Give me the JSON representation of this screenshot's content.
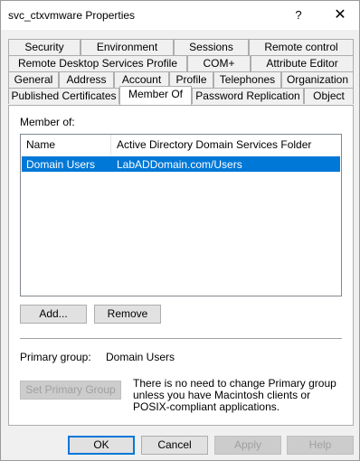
{
  "window": {
    "title": "svc_ctxvmware Properties",
    "help_glyph": "?",
    "close_glyph": "✕"
  },
  "tabs": {
    "row1": [
      "Security",
      "Environment",
      "Sessions",
      "Remote control"
    ],
    "row2": [
      "Remote Desktop Services Profile",
      "COM+",
      "Attribute Editor"
    ],
    "row3": [
      "General",
      "Address",
      "Account",
      "Profile",
      "Telephones",
      "Organization"
    ],
    "row4": [
      "Published Certificates",
      "Member Of",
      "Password Replication",
      "Object"
    ],
    "active": "Member Of"
  },
  "member_of": {
    "label": "Member of:",
    "columns": [
      "Name",
      "Active Directory Domain Services Folder"
    ],
    "rows": [
      {
        "name": "Domain Users",
        "folder": "LabADDomain.com/Users",
        "selected": true
      }
    ],
    "add_button": "Add...",
    "remove_button": "Remove"
  },
  "primary_group": {
    "label": "Primary group:",
    "value": "Domain Users",
    "set_button": "Set Primary Group",
    "note": "There is no need to change Primary group unless you have Macintosh clients or POSIX-compliant applications."
  },
  "footer": {
    "ok": "OK",
    "cancel": "Cancel",
    "apply": "Apply",
    "help": "Help"
  },
  "colors": {
    "selection": "#0078d7",
    "accent_border": "#0078d7"
  }
}
